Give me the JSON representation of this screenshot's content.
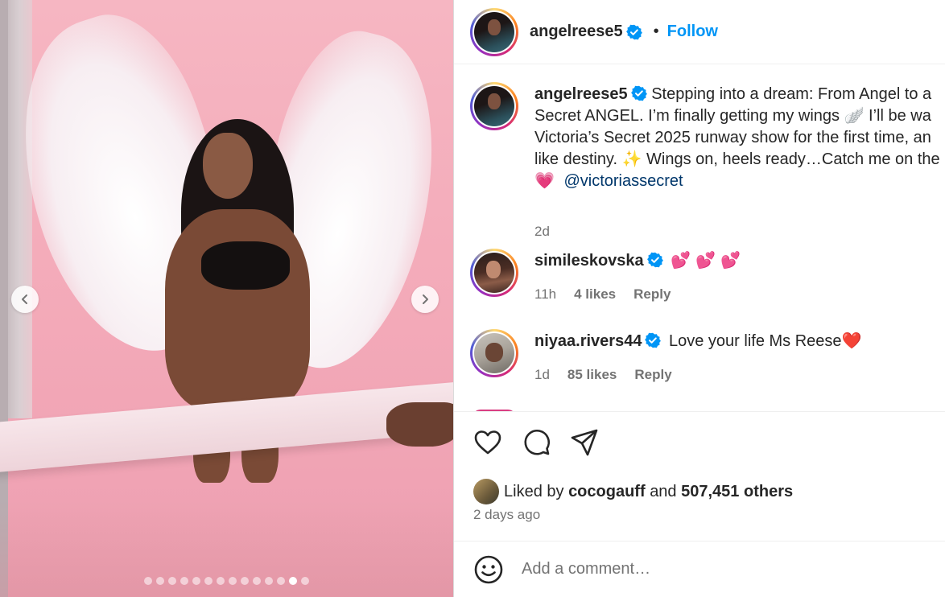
{
  "colors": {
    "accent": "#0095f6",
    "mention": "#00376b",
    "muted": "#737373",
    "verified": "#0095f6"
  },
  "carousel": {
    "total_slides": 14,
    "active_index": 12,
    "prev_icon": "chevron-left-icon",
    "next_icon": "chevron-right-icon"
  },
  "header": {
    "username": "angelreese5",
    "separator": "•",
    "follow_label": "Follow"
  },
  "caption": {
    "username": "angelreese5",
    "text_1": "Stepping into a dream: From Angel to a",
    "text_2": "Secret ANGEL. I’m finally getting my wings 🪽 I’ll be wa",
    "text_3": "Victoria’s Secret 2025 runway show for the first time, an",
    "text_4": "like destiny. ✨ Wings on, heels ready…Catch me on the",
    "emoji": "💗",
    "mention": "@victoriassecret",
    "time": "2d"
  },
  "comments": [
    {
      "username": "simileskovska",
      "text": "💕💕💕",
      "time": "11h",
      "likes": "4 likes",
      "reply": "Reply"
    },
    {
      "username": "niyaa.rivers44",
      "text": "Love your life Ms Reese❤️",
      "time": "1d",
      "likes": "85 likes",
      "reply": "Reply"
    }
  ],
  "actions": {
    "like_icon": "heart-icon",
    "comment_icon": "comment-icon",
    "share_icon": "share-icon"
  },
  "likes": {
    "prefix": "Liked by",
    "user": "cocogauff",
    "joiner": "and",
    "count": "507,451 others"
  },
  "posted_ago": "2 days ago",
  "add_comment": {
    "placeholder": "Add a comment…",
    "emoji_icon": "smiley-icon"
  }
}
